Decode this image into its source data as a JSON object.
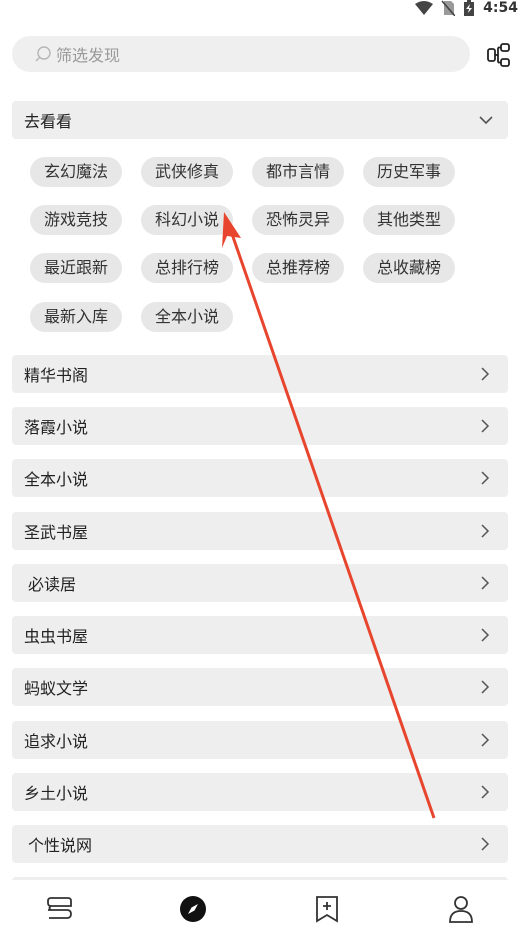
{
  "status": {
    "time": "4:54"
  },
  "search": {
    "placeholder": "筛选发现"
  },
  "group": {
    "title": "去看看"
  },
  "chips": [
    "玄幻魔法",
    "武侠修真",
    "都市言情",
    "历史军事",
    "游戏竞技",
    "科幻小说",
    "恐怖灵异",
    "其他类型",
    "最近跟新",
    "总排行榜",
    "总推荐榜",
    "总收藏榜",
    "最新入库",
    "全本小说"
  ],
  "sources": [
    "精华书阁",
    "落霞小说",
    "全本小说",
    "圣武书屋",
    "必读居",
    "虫虫书屋",
    "蚂蚁文学",
    "追求小说",
    "乡土小说",
    "个性说网"
  ],
  "nav": {
    "items": [
      "bookshelf-icon",
      "compass-icon",
      "bookmark-add-icon",
      "person-icon"
    ],
    "active_index": 1
  },
  "colors": {
    "annotation_arrow": "#e8452e"
  }
}
